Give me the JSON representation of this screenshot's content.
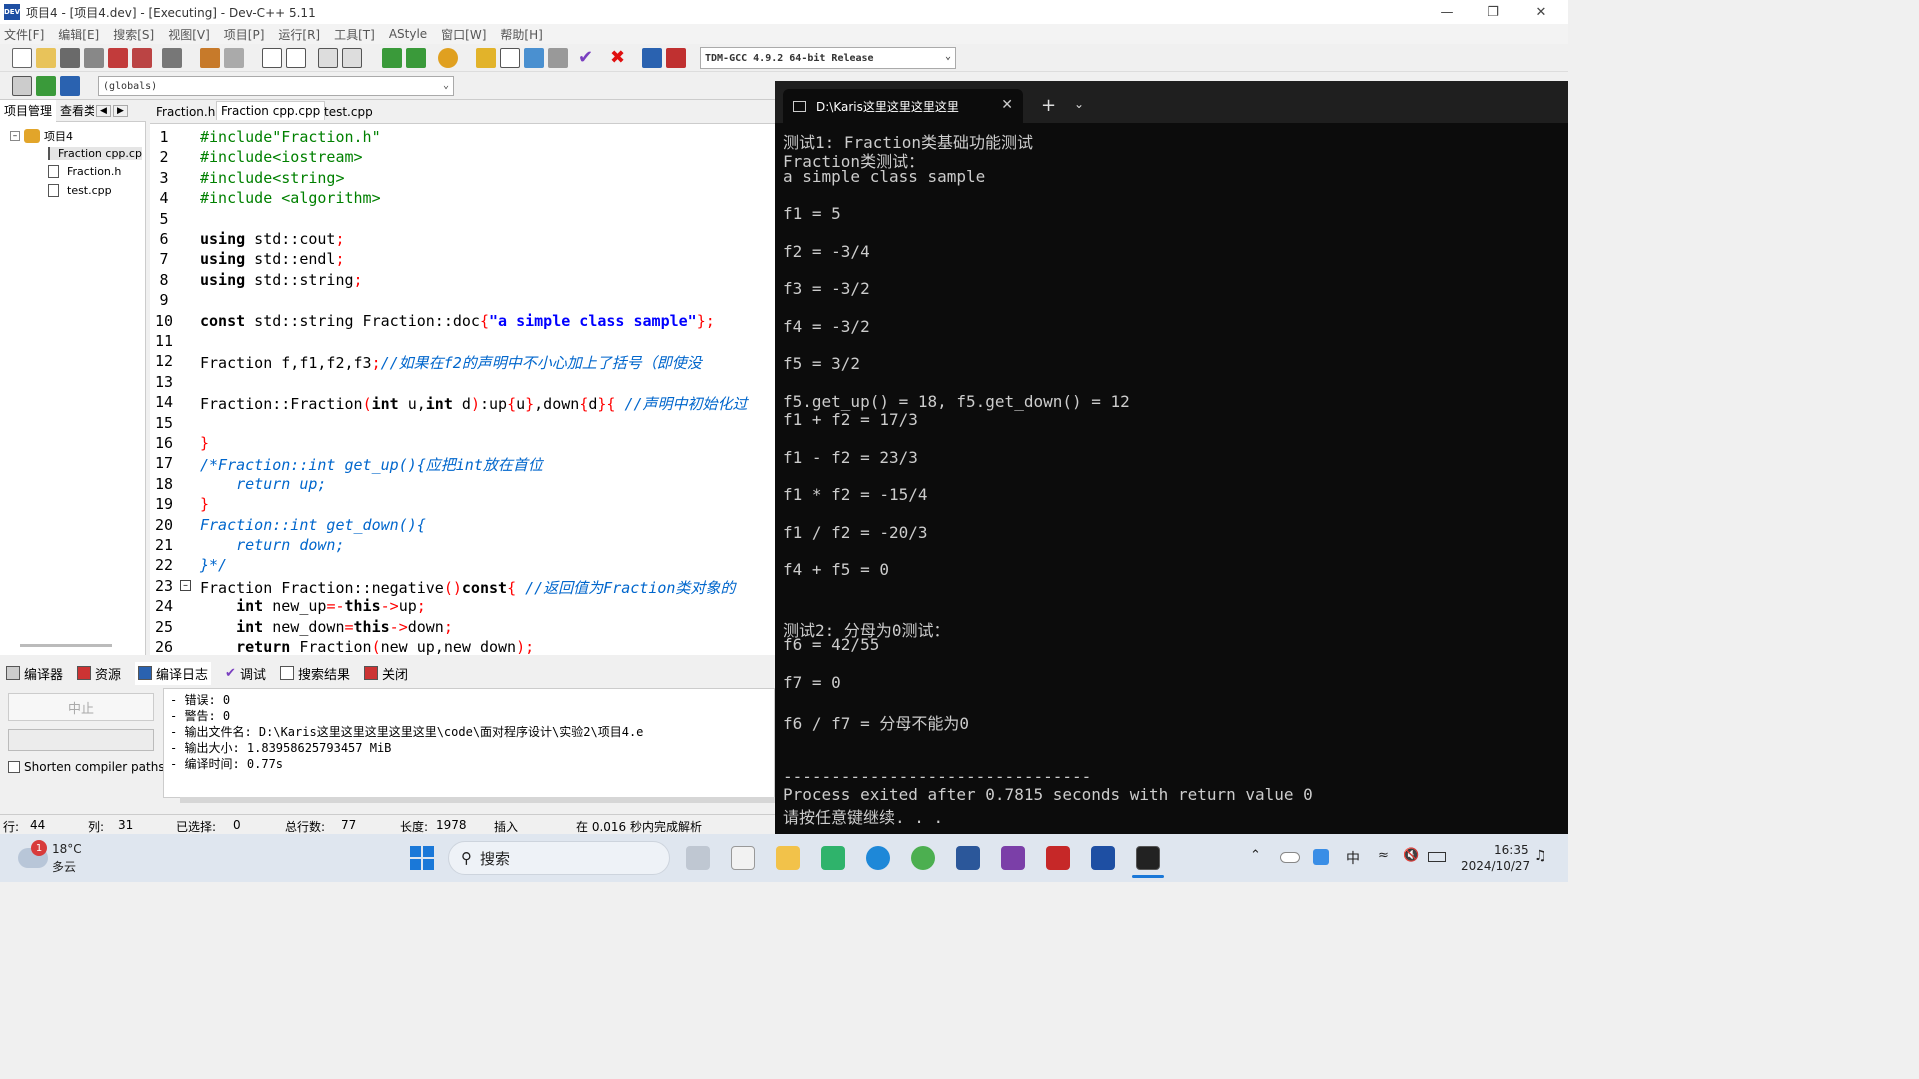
{
  "window": {
    "title": "项目4 - [项目4.dev] - [Executing] - Dev-C++ 5.11",
    "icon": "dev-cpp-icon"
  },
  "menu": [
    "文件[F]",
    "编辑[E]",
    "搜索[S]",
    "视图[V]",
    "项目[P]",
    "运行[R]",
    "工具[T]",
    "AStyle",
    "窗口[W]",
    "帮助[H]"
  ],
  "toolbar": {
    "compiler": "TDM-GCC 4.9.2 64-bit Release",
    "scope": "(globals)"
  },
  "left_panel": {
    "tabs": [
      "项目管理",
      "查看类"
    ],
    "tree": {
      "project": "项目4",
      "files": [
        "Fraction cpp.cpp",
        "Fraction.h",
        "test.cpp"
      ]
    }
  },
  "editor": {
    "tabs": [
      "Fraction.h",
      "Fraction cpp.cpp",
      "test.cpp"
    ],
    "active_tab": "Fraction cpp.cpp",
    "lines": [
      "#include\"Fraction.h\"",
      "#include<iostream>",
      "#include<string>",
      "#include <algorithm>",
      "",
      "using std::cout;",
      "using std::endl;",
      "using std::string;",
      "",
      "const std::string Fraction::doc{\"a simple class sample\"};",
      "",
      "Fraction f,f1,f2,f3;//如果在f2的声明中不小心加上了括号（即使没",
      "",
      "Fraction::Fraction(int u,int d):up{u},down{d}{ //声明中初始化过",
      "",
      "}",
      "/*Fraction::int get_up(){应把int放在首位",
      "    return up;",
      "}",
      "Fraction::int get_down(){",
      "    return down;",
      "}*/",
      "Fraction Fraction::negative()const{ //返回值为Fraction类对象的",
      "    int new_up=-this->up;",
      "    int new_down=this->down;",
      "    return Fraction(new_up,new_down);"
    ],
    "line_numbers": [
      "1",
      "2",
      "3",
      "4",
      "5",
      "6",
      "7",
      "8",
      "9",
      "10",
      "11",
      "12",
      "13",
      "14",
      "15",
      "16",
      "17",
      "18",
      "19",
      "20",
      "21",
      "22",
      "23",
      "24",
      "25",
      "26"
    ]
  },
  "bottom_tabs": [
    "编译器",
    "资源",
    "编译日志",
    "调试",
    "搜索结果",
    "关闭"
  ],
  "bottom_left": {
    "abort": "中止",
    "shorten_label": "Shorten compiler paths"
  },
  "compile_log": [
    "- 错误: 0",
    "- 警告: 0",
    "- 输出文件名: D:\\Karis这里这里这里这里这里\\code\\面对程序设计\\实验2\\项目4.e",
    "- 输出大小: 1.83958625793457 MiB",
    "- 编译时间: 0.77s"
  ],
  "status": {
    "row_label": "行:",
    "row": "44",
    "col_label": "列:",
    "col": "31",
    "sel_label": "已选择:",
    "sel": "0",
    "total_label": "总行数:",
    "total": "77",
    "len_label": "长度:",
    "len": "1978",
    "mode": "插入",
    "parse": "在 0.016 秒内完成解析"
  },
  "terminal": {
    "tab_title": "D:\\Karis这里这里这里这里",
    "lines": [
      "测试1: Fraction类基础功能测试",
      "Fraction类测试：",
      "a simple class sample",
      "",
      "f1 = 5",
      "",
      "f2 = -3/4",
      "",
      "f3 = -3/2",
      "",
      "f4 = -3/2",
      "",
      "f5 = 3/2",
      "",
      "f5.get_up() = 18, f5.get_down() = 12",
      "f1 + f2 = 17/3",
      "",
      "f1 - f2 = 23/3",
      "",
      "f1 * f2 = -15/4",
      "",
      "f1 / f2 = -20/3",
      "",
      "f4 + f5 = 0",
      "",
      "",
      "测试2: 分母为0测试：",
      "f6 = 42/55",
      "",
      "f7 = 0",
      "",
      "f6 / f7 = 分母不能为0",
      "",
      "",
      "--------------------------------",
      "Process exited after 0.7815 seconds with return value 0",
      "请按任意键继续. . ."
    ]
  },
  "taskbar": {
    "weather_temp": "18°C",
    "weather_desc": "多云",
    "weather_badge": "1",
    "search": "搜索",
    "ime": "中",
    "time": "16:35",
    "date": "2024/10/27"
  },
  "colors": {
    "preprocessor": "#008000",
    "keyword": "#000000",
    "comment": "#0066cc",
    "string": "#0000ff",
    "operator": "#ff0000"
  }
}
